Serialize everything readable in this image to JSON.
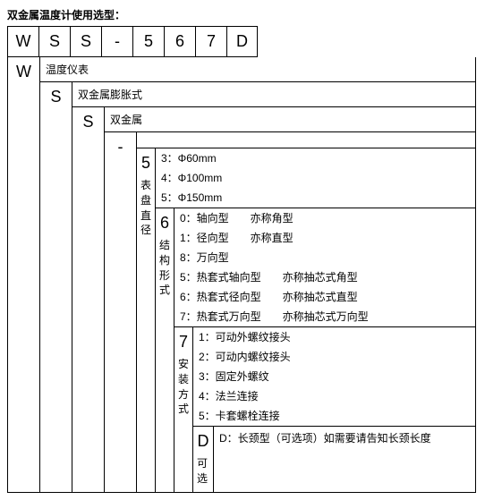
{
  "title": "双金属温度计使用选型：",
  "code": [
    "W",
    "S",
    "S",
    "-",
    "5",
    "6",
    "7",
    "D"
  ],
  "levels": {
    "W": {
      "char": "W",
      "label": "温度仪表"
    },
    "S1": {
      "char": "S",
      "label": "双金属膨胀式"
    },
    "S2": {
      "char": "S",
      "label": "双金属"
    },
    "dash": {
      "char": "-",
      "label": ""
    },
    "d5": {
      "char": "5",
      "vlabel": "表盘直径",
      "options": [
        "3：Φ60mm",
        "4：Φ100mm",
        "5：Φ150mm"
      ]
    },
    "d6": {
      "char": "6",
      "vlabel": "结构形式",
      "options": [
        "0：轴向型　　亦称角型",
        "1：径向型　　亦称直型",
        "8：万向型",
        "5：热套式轴向型　　亦称抽芯式角型",
        "6：热套式径向型　　亦称抽芯式直型",
        "7：热套式万向型　　亦称抽芯式万向型"
      ]
    },
    "d7": {
      "char": "7",
      "vlabel": "安装方式",
      "options": [
        "1：可动外螺纹接头",
        "2：可动内螺纹接头",
        "3：固定外螺纹",
        "4：法兰连接",
        "5：卡套螺栓连接"
      ]
    },
    "dD": {
      "char": "D",
      "vlabel": "可选",
      "desc": "D：长颈型（可选项）如需要请告知长颈长度"
    }
  }
}
